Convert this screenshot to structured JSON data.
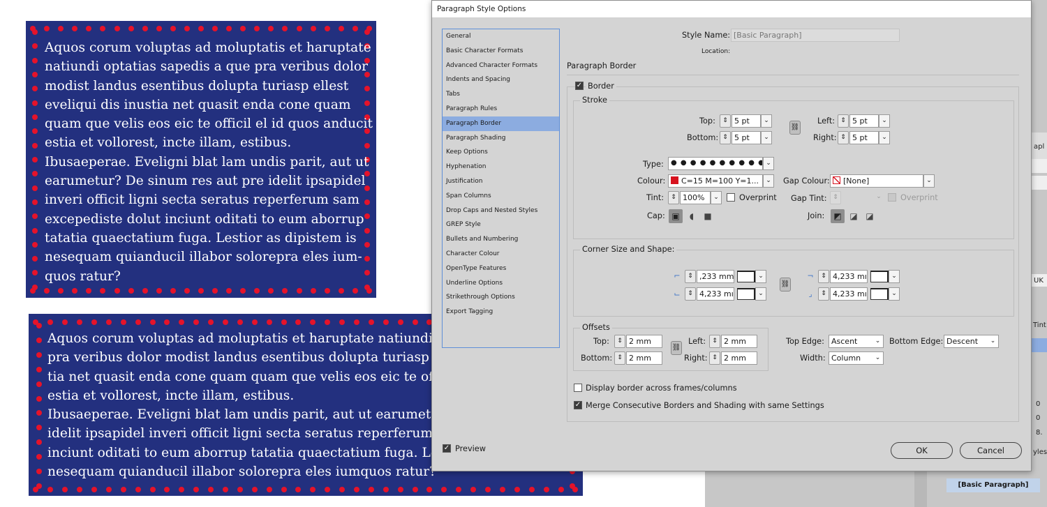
{
  "frames": [
    {
      "lines": [
        "Aquos corum voluptas ad moluptatis et haruptate",
        "natiundi optatias sapedis a que pra veribus dolor",
        "modist landus esentibus dolupta turiasp ellest",
        "eveliqui dis inustia net quasit enda cone quam",
        "quam que velis eos eic te officil el id quos anducit",
        "estia et vollorest, incte illam, estibus.",
        "Ibusaeperae. Eveligni blat lam undis parit, aut ut",
        "earumetur? De sinum res aut pre idelit ipsapidel",
        "inveri officit ligni secta seratus reperferum sam",
        "excepediste dolut inciunt oditati to eum aborrup",
        "tatatia quaectatium fuga. Lestior as dipistem is",
        "nesequam quianducil illabor solorepra eles ium-",
        "quos ratur?"
      ]
    },
    {
      "lines": [
        "Aquos corum voluptas ad moluptatis et haruptate natiundi op",
        "pra veribus dolor modist landus esentibus dolupta turiasp ell",
        "tia net quasit enda cone quam quam que velis eos eic te offici",
        "estia et vollorest, incte illam, estibus.",
        "Ibusaeperae. Eveligni blat lam undis parit, aut ut earumetur?",
        "idelit ipsapidel inveri officit ligni secta seratus reperferum sam",
        "inciunt oditati to eum aborrup tatatia quaectatium fuga. Lest",
        "nesequam quianducil illabor solorepra eles iumquos ratur?"
      ]
    }
  ],
  "background_panel": {
    "partial_labels": [
      "apl",
      "UK",
      "Tint:",
      "0",
      "0",
      "8.",
      "yles"
    ],
    "style_item": "[Basic Paragraph]"
  },
  "dialog": {
    "title": "Paragraph Style Options",
    "categories": [
      "General",
      "Basic Character Formats",
      "Advanced Character Formats",
      "Indents and Spacing",
      "Tabs",
      "Paragraph Rules",
      "Paragraph Border",
      "Paragraph Shading",
      "Keep Options",
      "Hyphenation",
      "Justification",
      "Span Columns",
      "Drop Caps and Nested Styles",
      "GREP Style",
      "Bullets and Numbering",
      "Character Colour",
      "OpenType Features",
      "Underline Options",
      "Strikethrough Options",
      "Export Tagging"
    ],
    "selected_category": "Paragraph Border",
    "style_name_label": "Style Name:",
    "style_name_value": "[Basic Paragraph]",
    "location_label": "Location:",
    "section_title": "Paragraph Border",
    "border_label": "Border",
    "border_checked": true,
    "stroke": {
      "group_label": "Stroke",
      "top_label": "Top:",
      "top_value": "5 pt",
      "bottom_label": "Bottom:",
      "bottom_value": "5 pt",
      "left_label": "Left:",
      "left_value": "5 pt",
      "right_label": "Right:",
      "right_value": "5 pt",
      "type_label": "Type:",
      "type_value": "● ● ● ● ● ● ● ● ● ●",
      "colour_label": "Colour:",
      "colour_value": "C=15 M=100 Y=1...",
      "colour_swatch": "#d7131f",
      "gap_colour_label": "Gap Colour:",
      "gap_colour_value": "[None]",
      "tint_label": "Tint:",
      "tint_value": "100%",
      "overprint_label": "Overprint",
      "gap_tint_label": "Gap Tint:",
      "gap_overprint_label": "Overprint",
      "cap_label": "Cap:",
      "join_label": "Join:"
    },
    "corner": {
      "group_label": "Corner Size and Shape:",
      "tl_value": ",233 mm",
      "bl_value": "4,233 mı",
      "tr_value": "4,233 mı",
      "br_value": "4,233 mı"
    },
    "offsets": {
      "group_label": "Offsets",
      "top_label": "Top:",
      "top_value": "2 mm",
      "bottom_label": "Bottom:",
      "bottom_value": "2 mm",
      "left_label": "Left:",
      "left_value": "2 mm",
      "right_label": "Right:",
      "right_value": "2 mm",
      "top_edge_label": "Top Edge:",
      "top_edge_value": "Ascent",
      "bottom_edge_label": "Bottom Edge:",
      "bottom_edge_value": "Descent",
      "width_label": "Width:",
      "width_value": "Column"
    },
    "display_across_label": "Display border across frames/columns",
    "display_across_checked": false,
    "merge_label": "Merge Consecutive Borders and Shading with same Settings",
    "merge_checked": true,
    "preview_label": "Preview",
    "preview_checked": true,
    "ok_label": "OK",
    "cancel_label": "Cancel"
  },
  "colors": {
    "frame_bg": "#23307f",
    "dot": "#e5132a",
    "selection": "#8cace0"
  }
}
